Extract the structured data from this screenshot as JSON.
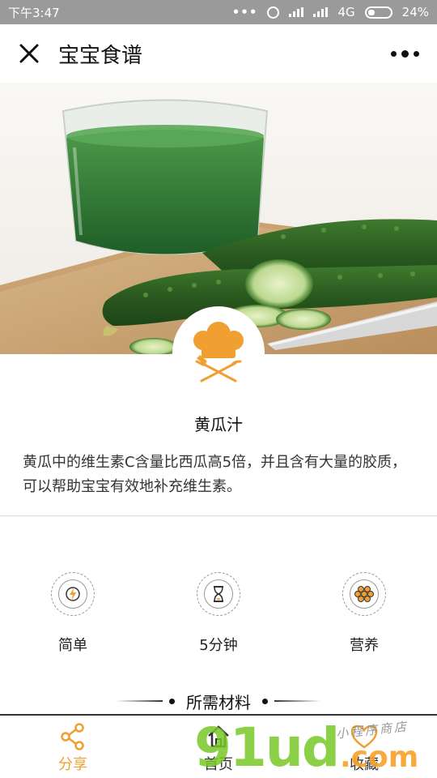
{
  "status_bar": {
    "time": "下午3:47",
    "network": "4G",
    "battery": "24%"
  },
  "navbar": {
    "title": "宝宝食谱",
    "close_icon": "close-icon",
    "more_icon": "more-dots-icon"
  },
  "recipe": {
    "name": "黄瓜汁",
    "description": "黄瓜中的维生素C含量比西瓜高5倍，并且含有大量的胶质，可以帮助宝宝有效地补充维生素。",
    "avatar_icon": "chef-hat-icon"
  },
  "features": [
    {
      "label": "简单",
      "icon": "lightning-icon"
    },
    {
      "label": "5分钟",
      "icon": "hourglass-icon"
    },
    {
      "label": "营养",
      "icon": "nutrition-icon"
    }
  ],
  "materials": {
    "title": "所需材料"
  },
  "tabbar": {
    "share_label": "分享",
    "home_label": "首页",
    "fav_label": "收藏"
  },
  "watermark": {
    "main": "91ud",
    "suffix": ".com",
    "tagline": "小程序商店"
  },
  "colors": {
    "accent": "#f0a030",
    "status_bar": "#9a9a9a"
  }
}
